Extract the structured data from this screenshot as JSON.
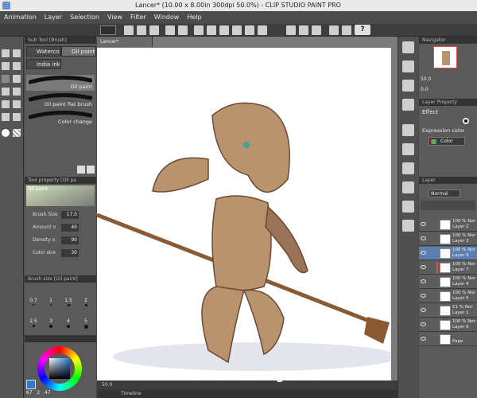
{
  "window": {
    "title": "Lancer* (10.00 x 8.00in 300dpi 50.0%) - CLIP STUDIO PAINT PRO"
  },
  "menu": [
    "Animation",
    "Layer",
    "Selection",
    "View",
    "Filter",
    "Window",
    "Help"
  ],
  "toolbar": {
    "help_label": "?"
  },
  "subtool": {
    "header": "Sub Tool [Brush]",
    "tabs": [
      "Waterco",
      "Oil paint",
      "India ink"
    ],
    "brushes": [
      "Oil paint",
      "Oil paint flat brush",
      "Color change"
    ]
  },
  "toolprop": {
    "header": "Tool property [Oil pa",
    "brush_name": "Oil paint",
    "rows": [
      {
        "label": "Brush Size",
        "value": "17.0"
      },
      {
        "label": "Amount o",
        "value": "40"
      },
      {
        "label": "Density o",
        "value": "90"
      },
      {
        "label": "Color stre",
        "value": "30"
      }
    ]
  },
  "brushsize": {
    "header": "Brush size [Oil paint]",
    "sizes": [
      "0.7",
      "1",
      "1.5",
      "2",
      "2.5",
      "3",
      "4",
      "5"
    ]
  },
  "color": {
    "values": [
      "67",
      "2",
      "47"
    ]
  },
  "canvas": {
    "tab": "Lancer*",
    "status_zoom": "50.0",
    "timeline_label": "Timeline",
    "status_number": "3"
  },
  "navigator": {
    "header": "Navigator",
    "zoom": "50.0",
    "rotation": "0.0"
  },
  "layerprop": {
    "header": "Layer Property",
    "effect_label": "Effect",
    "expression_label": "Expression color",
    "expression_value": "Color"
  },
  "layers": {
    "header": "Layer",
    "blend_mode": "Normal",
    "items": [
      {
        "blend": "100 % Nor",
        "name": "Layer 2"
      },
      {
        "blend": "100 % Nor",
        "name": "Layer 3"
      },
      {
        "blend": "100 % Nor",
        "name": "Layer 8"
      },
      {
        "blend": "100 % Nor",
        "name": "Layer 7"
      },
      {
        "blend": "100 % Nor",
        "name": "Layer 4"
      },
      {
        "blend": "100 % Nor",
        "name": "Layer 5"
      },
      {
        "blend": "11 % Nor",
        "name": "Layer 1"
      },
      {
        "blend": "100 % Nor",
        "name": "Layer 6"
      },
      {
        "blend": "",
        "name": "Pape"
      }
    ]
  },
  "colors": {
    "accent": "#5a7fb0",
    "skin": "#b9926e",
    "canvas": "#ffffff"
  }
}
